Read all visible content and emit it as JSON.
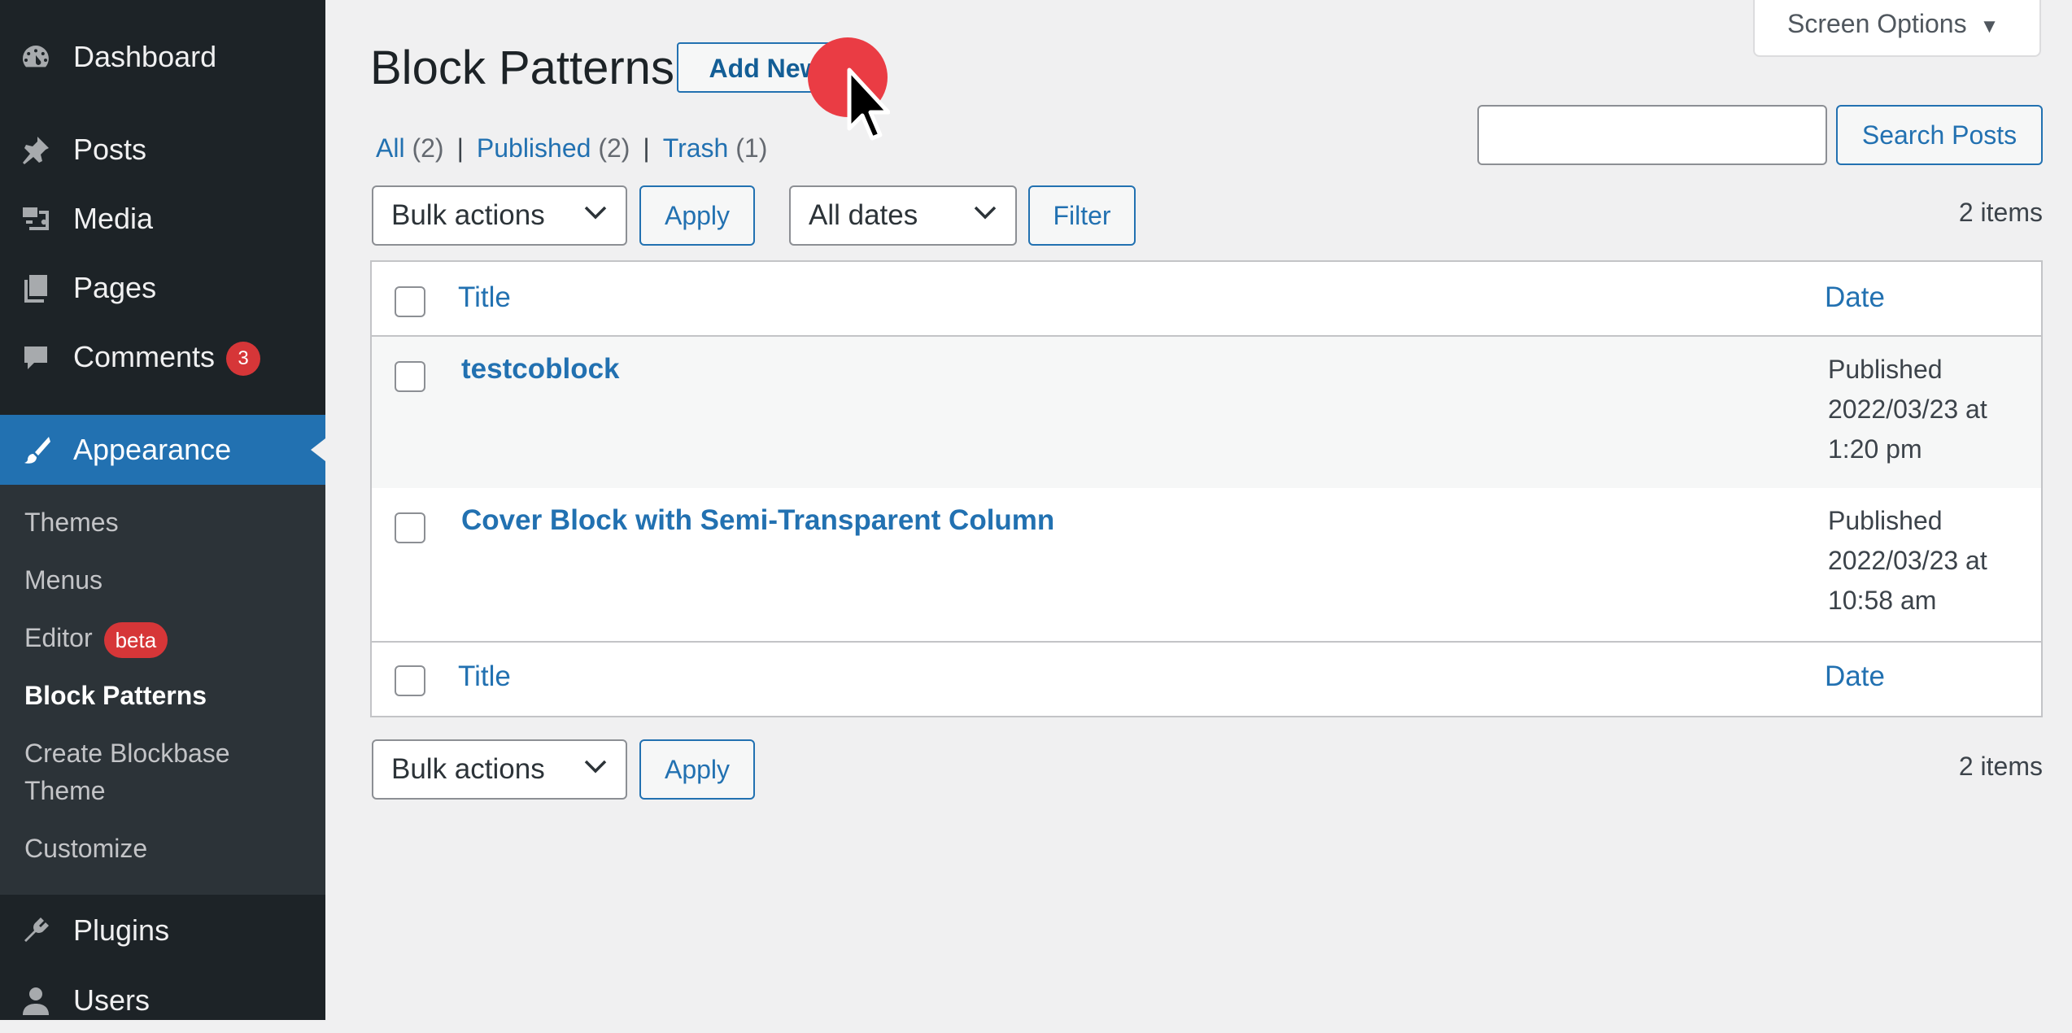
{
  "sidebar": {
    "menu": [
      {
        "label": "Dashboard",
        "icon": "dashboard-icon"
      },
      {
        "label": "Posts",
        "icon": "pin-icon"
      },
      {
        "label": "Media",
        "icon": "media-icon"
      },
      {
        "label": "Pages",
        "icon": "pages-icon"
      },
      {
        "label": "Comments",
        "icon": "comment-icon",
        "badge": "3"
      },
      {
        "label": "Appearance",
        "icon": "paintbrush-icon"
      },
      {
        "label": "Plugins",
        "icon": "plugin-icon"
      },
      {
        "label": "Users",
        "icon": "user-icon"
      }
    ],
    "submenu": [
      {
        "label": "Themes"
      },
      {
        "label": "Menus"
      },
      {
        "label": "Editor",
        "badge": "beta"
      },
      {
        "label": "Block Patterns"
      },
      {
        "label": "Create Blockbase Theme"
      },
      {
        "label": "Customize"
      }
    ]
  },
  "header": {
    "title": "Block Patterns",
    "add_new": "Add New",
    "screen_options": "Screen Options"
  },
  "filters": {
    "all_label": "All",
    "all_count": "(2)",
    "published_label": "Published",
    "published_count": "(2)",
    "trash_label": "Trash",
    "trash_count": "(1)",
    "separator": "|"
  },
  "search": {
    "value": "",
    "button": "Search Posts"
  },
  "toolbar_top": {
    "bulk_actions": "Bulk actions",
    "apply": "Apply",
    "dates": "All dates",
    "filter": "Filter",
    "items": "2 items"
  },
  "table": {
    "columns": {
      "title": "Title",
      "date": "Date"
    },
    "rows": [
      {
        "title": "testcoblock",
        "status": "Published",
        "date": "2022/03/23 at",
        "time": "1:20 pm"
      },
      {
        "title": "Cover Block with Semi-Transparent Column",
        "status": "Published",
        "date": "2022/03/23 at",
        "time": "10:58 am"
      }
    ]
  },
  "toolbar_bottom": {
    "bulk_actions": "Bulk actions",
    "apply": "Apply",
    "items": "2 items"
  },
  "colors": {
    "sidebar_bg": "#1d2327",
    "submenu_bg": "#2c3338",
    "accent": "#2271b1",
    "badge": "#d63638",
    "click_marker": "#ea3c44"
  }
}
